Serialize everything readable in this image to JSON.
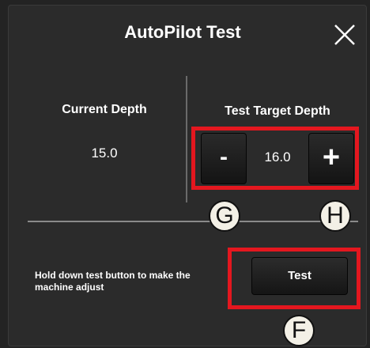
{
  "dialog": {
    "title": "AutoPilot Test",
    "close_icon": "close-icon"
  },
  "current": {
    "label": "Current Depth",
    "value": "15.0"
  },
  "target": {
    "label": "Test Target Depth",
    "value": "16.0",
    "minus_label": "-",
    "plus_label": "+"
  },
  "markers": {
    "g": "G",
    "h": "H",
    "f": "F"
  },
  "hint": "Hold down test button to make the machine adjust",
  "test_button_label": "Test",
  "colors": {
    "background": "#2b2b2b",
    "highlight": "#e4171f",
    "text": "#ffffff"
  }
}
